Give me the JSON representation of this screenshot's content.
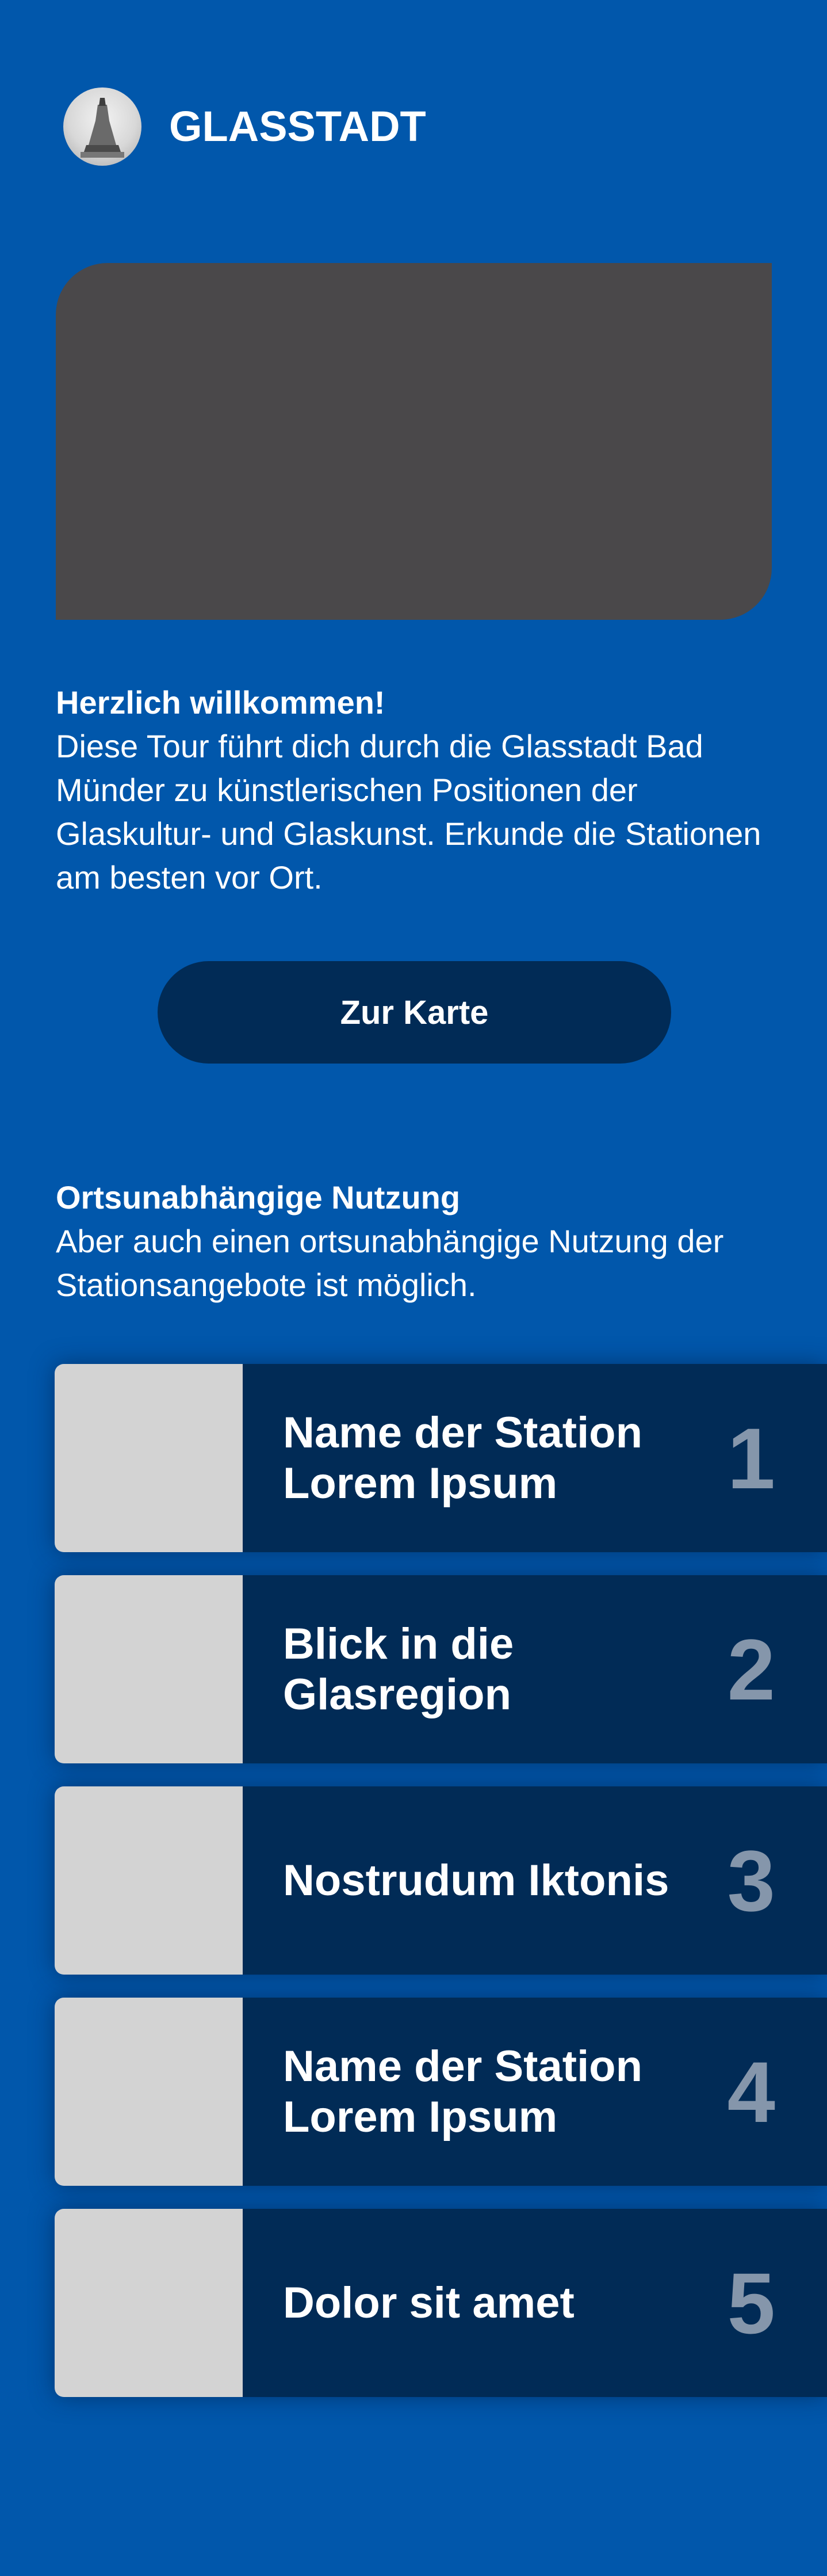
{
  "brand": {
    "name": "GLASSTADT"
  },
  "welcome": {
    "title": "Herzlich willkommen!",
    "text": "Diese Tour führt dich durch die Glasstadt Bad Münder zu künstlerischen Positionen der Glaskultur- und Glaskunst. Erkunde die Stationen am besten vor Ort."
  },
  "cta": {
    "label": "Zur Karte"
  },
  "offsite": {
    "title": "Ortsunabhängige Nutzung",
    "text": "Aber auch einen ortsunabhängige Nutzung der Stationsangebote ist möglich."
  },
  "stations": [
    {
      "name": "Name der Station Lorem Ipsum",
      "number": "1"
    },
    {
      "name": "Blick in die Glasregion",
      "number": "2"
    },
    {
      "name": "Nostrudum Iktonis",
      "number": "3"
    },
    {
      "name": "Name der Station Lorem Ipsum",
      "number": "4"
    },
    {
      "name": "Dolor sit amet",
      "number": "5"
    }
  ],
  "colors": {
    "background": "#0157ab",
    "dark": "#012b56",
    "hero": "#4a484a",
    "thumb": "#d3d3d3",
    "number": "#8596ab"
  }
}
